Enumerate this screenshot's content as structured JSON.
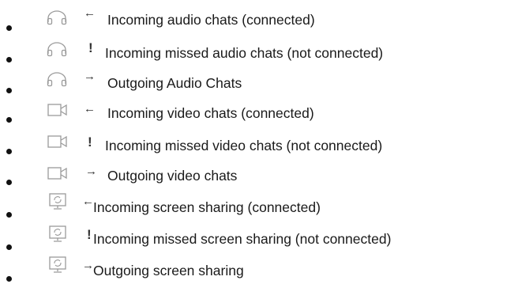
{
  "legend": {
    "items": [
      {
        "icon": "headset-icon",
        "marker": "←",
        "label": "Incoming audio chats (connected)"
      },
      {
        "icon": "headset-icon",
        "marker": "!",
        "label": "Incoming missed audio chats (not connected)"
      },
      {
        "icon": "headset-icon",
        "marker": "→",
        "label": "Outgoing Audio Chats"
      },
      {
        "icon": "video-camera-icon",
        "marker": "←",
        "label": "Incoming video chats (connected)"
      },
      {
        "icon": "video-camera-icon",
        "marker": "!",
        "label": "Incoming missed video chats (not connected)"
      },
      {
        "icon": "video-camera-icon",
        "marker": "→",
        "label": "Outgoing video chats"
      },
      {
        "icon": "screen-share-icon",
        "marker": "←",
        "label": "Incoming screen sharing (connected)"
      },
      {
        "icon": "screen-share-icon",
        "marker": "!",
        "label": "Incoming missed screen sharing (not connected)"
      },
      {
        "icon": "screen-share-icon",
        "marker": "→",
        "label": "Outgoing screen sharing"
      }
    ]
  }
}
